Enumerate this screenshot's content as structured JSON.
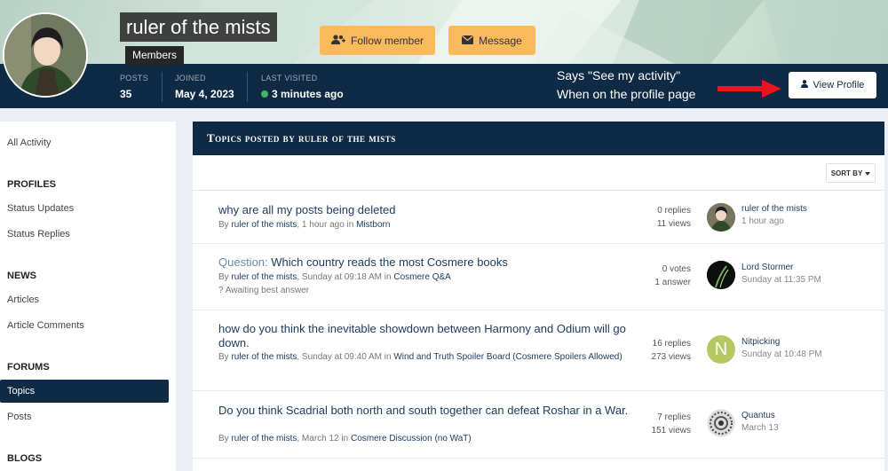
{
  "profile": {
    "name": "ruler of the mists",
    "group": "Members",
    "follow_label": "Follow member",
    "message_label": "Message",
    "stats": [
      {
        "label": "POSTS",
        "value": "35"
      },
      {
        "label": "JOINED",
        "value": "May 4, 2023"
      },
      {
        "label": "LAST VISITED",
        "value": "3 minutes ago"
      }
    ],
    "view_profile_label": "View Profile"
  },
  "annotation": {
    "line1": "Says \"See my activity\"",
    "line2": "When on the profile page"
  },
  "sidebar": {
    "all_activity": "All Activity",
    "sections": [
      {
        "heading": "PROFILES",
        "items": [
          "Status Updates",
          "Status Replies"
        ]
      },
      {
        "heading": "NEWS",
        "items": [
          "Articles",
          "Article Comments"
        ]
      },
      {
        "heading": "FORUMS",
        "items": [
          "Topics",
          "Posts"
        ]
      },
      {
        "heading": "BLOGS",
        "items": []
      }
    ],
    "active_item": "Topics"
  },
  "main": {
    "heading": "Topics posted by ruler of the mists",
    "sort_label": "SORT BY"
  },
  "topics": [
    {
      "prefix": "",
      "title": "why are all my posts being deleted",
      "by": "By",
      "author": "ruler of the mists",
      "time": ", 1 hour ago in",
      "forum": "Mistborn",
      "extra": "",
      "stat1": "0 replies",
      "stat2": "11 views",
      "last_user": "ruler of the mists",
      "last_time": "1 hour ago"
    },
    {
      "prefix": "Question:",
      "title": "Which country reads the most Cosmere books",
      "by": "By",
      "author": "ruler of the mists",
      "time": ", Sunday at 09:18 AM in",
      "forum": "Cosmere Q&A",
      "extra": "? Awaiting best answer",
      "stat1": "0 votes",
      "stat2": "1 answer",
      "last_user": "Lord Stormer",
      "last_time": "Sunday at 11:35 PM"
    },
    {
      "prefix": "",
      "title": "how do you think the inevitable showdown between Harmony and Odium will go down.",
      "by": "By",
      "author": "ruler of the mists",
      "time": ", Sunday at 09:40 AM in",
      "forum": "Wind and Truth Spoiler Board (Cosmere Spoilers Allowed)",
      "extra": "",
      "stat1": "16 replies",
      "stat2": "273 views",
      "last_user": "Nitpicking",
      "last_initial": "N",
      "last_time": "Sunday at 10:48 PM"
    },
    {
      "prefix": "",
      "title": "Do you think Scadrial both north and south together can defeat Roshar in a War.",
      "by": "By",
      "author": "ruler of the mists",
      "time": ", March 12 in",
      "forum": "Cosmere Discussion (no WaT)",
      "extra": "",
      "stat1": "7 replies",
      "stat2": "151 views",
      "last_user": "Quantus",
      "last_time": "March 13"
    }
  ],
  "colors": {
    "accent": "#0f2a44",
    "button": "#f9ba5c",
    "arrow": "#e8151b",
    "online": "#3fb56a"
  },
  "icons": [
    "follow-user-icon",
    "envelope-icon",
    "user-icon",
    "sort-caret-icon",
    "online-dot-icon",
    "red-arrow-icon"
  ]
}
